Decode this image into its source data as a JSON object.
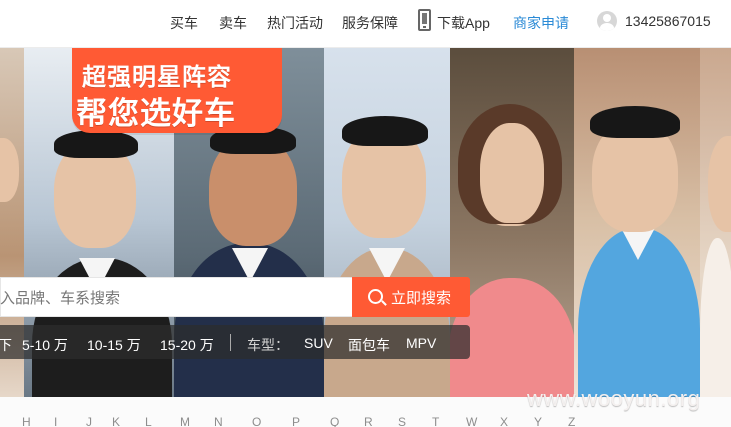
{
  "nav": {
    "items": [
      {
        "label": "买车"
      },
      {
        "label": "卖车"
      },
      {
        "label": "热门活动"
      },
      {
        "label": "服务保障"
      },
      {
        "label": "下载App"
      },
      {
        "label": "商家申请"
      }
    ],
    "user_phone": "13425867015"
  },
  "promo": {
    "line1": "超强明星阵容",
    "line2": "帮您选好车"
  },
  "search": {
    "placeholder": "入品牌、车系搜索",
    "button_label": "立即搜索"
  },
  "filters": {
    "price_ranges": [
      "下",
      "5-10 万",
      "10-15 万",
      "15-20 万"
    ],
    "type_label": "车型：",
    "types": [
      "SUV",
      "面包车",
      "MPV"
    ]
  },
  "alphabet": [
    "H",
    "I",
    "J",
    "K",
    "L",
    "M",
    "N",
    "O",
    "P",
    "Q",
    "R",
    "S",
    "T",
    "W",
    "X",
    "Y",
    "Z"
  ],
  "watermark": "www.wooyun.org",
  "colors": {
    "accent": "#ff5a34",
    "link_blue": "#2a8ad6"
  }
}
